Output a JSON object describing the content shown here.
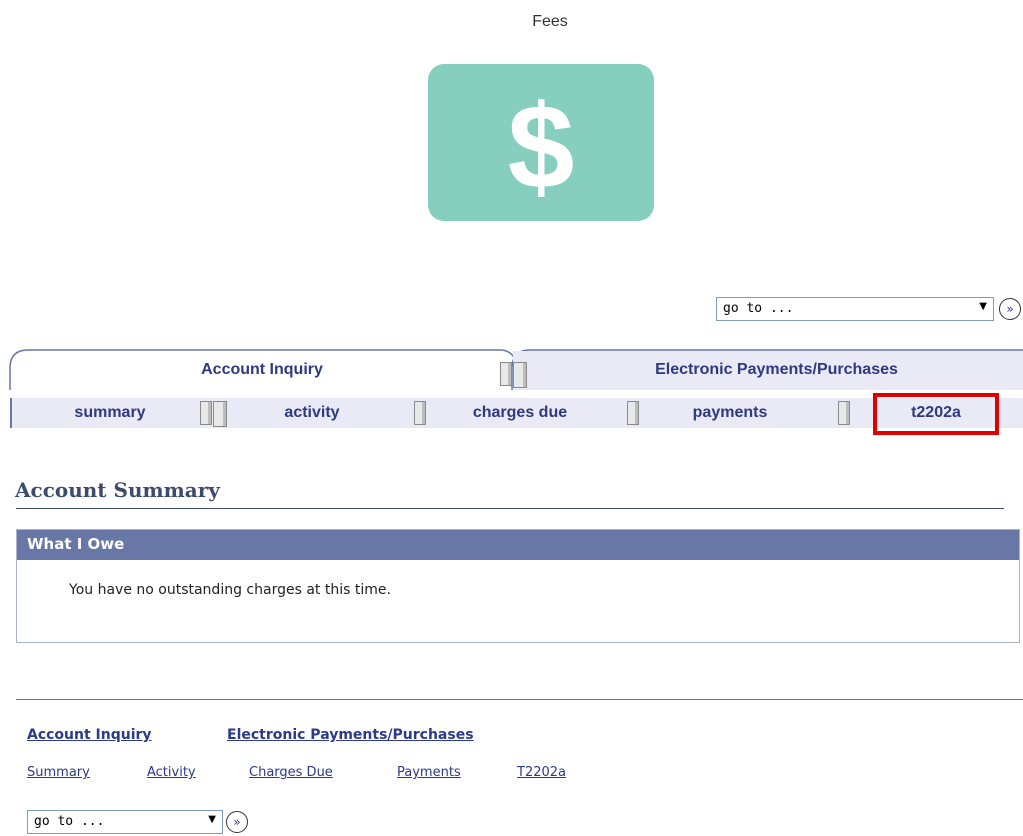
{
  "header": {
    "title": "Fees",
    "tile_icon": "dollar-icon",
    "tile_color": "#86cfbf"
  },
  "goto": {
    "top_value": "go to ...",
    "bottom_value": "go to ..."
  },
  "tabs": [
    {
      "label": "Account Inquiry",
      "active": true
    },
    {
      "label": "Electronic Payments/Purchases",
      "active": false
    }
  ],
  "subtabs": [
    {
      "label": "summary"
    },
    {
      "label": "activity"
    },
    {
      "label": "charges due"
    },
    {
      "label": "payments"
    },
    {
      "label": "t2202a",
      "highlighted": true
    }
  ],
  "summary": {
    "heading": "Account Summary",
    "box_title": "What I Owe",
    "message": "You have no outstanding charges at this time."
  },
  "footer": {
    "main_links": [
      "Account Inquiry",
      "Electronic Payments/Purchases"
    ],
    "sub_links": [
      "Summary",
      "Activity",
      "Charges Due",
      "Payments",
      "T2202a"
    ]
  },
  "colors": {
    "accent": "#2e3a80",
    "box_header": "#6977a6",
    "highlight": "#e00000"
  }
}
